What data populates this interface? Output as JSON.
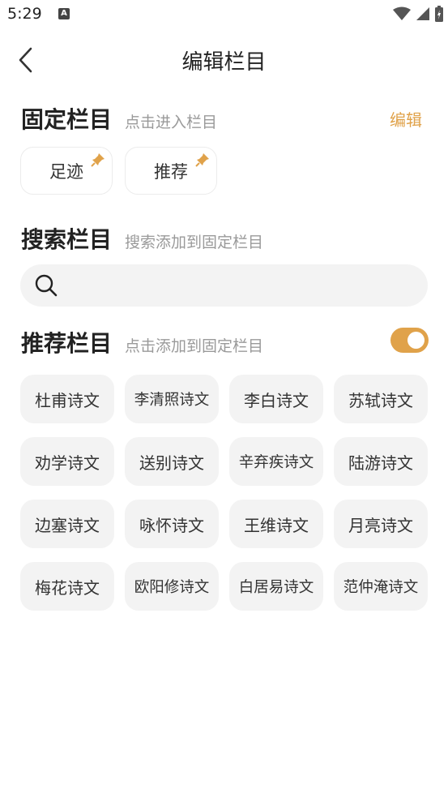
{
  "status": {
    "time": "5:29",
    "notif": "A"
  },
  "header": {
    "title": "编辑栏目"
  },
  "fixed": {
    "title": "固定栏目",
    "hint": "点击进入栏目",
    "edit_label": "编辑",
    "items": [
      {
        "label": "足迹"
      },
      {
        "label": "推荐"
      }
    ]
  },
  "search": {
    "title": "搜索栏目",
    "hint": "搜索添加到固定栏目",
    "value": ""
  },
  "recommend": {
    "title": "推荐栏目",
    "hint": "点击添加到固定栏目",
    "toggle_on": true,
    "items": [
      {
        "label": "杜甫诗文"
      },
      {
        "label": "李清照诗文"
      },
      {
        "label": "李白诗文"
      },
      {
        "label": "苏轼诗文"
      },
      {
        "label": "劝学诗文"
      },
      {
        "label": "送别诗文"
      },
      {
        "label": "辛弃疾诗文"
      },
      {
        "label": "陆游诗文"
      },
      {
        "label": "边塞诗文"
      },
      {
        "label": "咏怀诗文"
      },
      {
        "label": "王维诗文"
      },
      {
        "label": "月亮诗文"
      },
      {
        "label": "梅花诗文"
      },
      {
        "label": "欧阳修诗文"
      },
      {
        "label": "白居易诗文"
      },
      {
        "label": "范仲淹诗文"
      }
    ]
  },
  "colors": {
    "accent": "#e0a24a",
    "chip_bg": "#f3f3f3",
    "hint": "#9a9a9a"
  }
}
